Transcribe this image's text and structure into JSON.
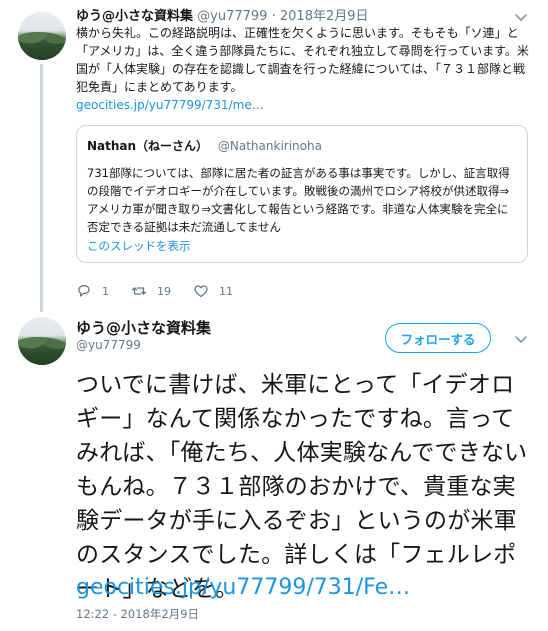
{
  "tweet1": {
    "name": "ゆう@小さな資料集",
    "handle": "@yu77799",
    "dot": "·",
    "date": "2018年2月9日",
    "body": "横から失礼。この経路説明は、正確性を欠くように思います。そもそも「ソ連」と「アメリカ」は、全く違う部隊員たちに、それぞれ独立して尋問を行っています。米国が「人体実験」の存在を認識して調査を行った経緯については、「７３１部隊と戦犯免責」にまとめてあります。",
    "link": "geocities.jp/yu77799/731/me…",
    "quote": {
      "name": "Nathan（ねーさん）",
      "handle": "@Nathankirinoha",
      "body": "731部隊については、部隊に居た者の証言がある事は事実です。しかし、証言取得の段階でイデオロギーが介在しています。敗戦後の満州でロシア将校が供述取得⇒アメリカ軍が聞き取り⇒文書化して報告という経路です。非道な人体実験を完全に否定できる証拠は未だ流通してません",
      "thread_link": "このスレッドを表示"
    },
    "reply_count": "1",
    "retweet_count": "19",
    "like_count": "11",
    "icons": [
      "reply-icon",
      "retweet-icon",
      "like-icon",
      "chevron-down-icon"
    ]
  },
  "tweet2": {
    "name": "ゆう@小さな資料集",
    "handle": "@yu77799",
    "follow_label": "フォローする",
    "body": "ついでに書けば、米軍にとって「イデオロギー」なんて関係なかったですね。言ってみれば、「俺たち、人体実験なんでできないもんね。７３１部隊のおかけで、貴重な実験データが手に入るぞお」というのが米軍のスタンスでした。詳しくは「フェルレポート」などを。",
    "link": "geocities.jp/yu77799/731/Fe…",
    "timestamp": "12:22 - 2018年2月9日"
  },
  "colors": {
    "link": "#1b95e0",
    "accent": "#1da1f2",
    "muted": "#657786",
    "border": "#ccd6dd",
    "text": "#14171a"
  }
}
